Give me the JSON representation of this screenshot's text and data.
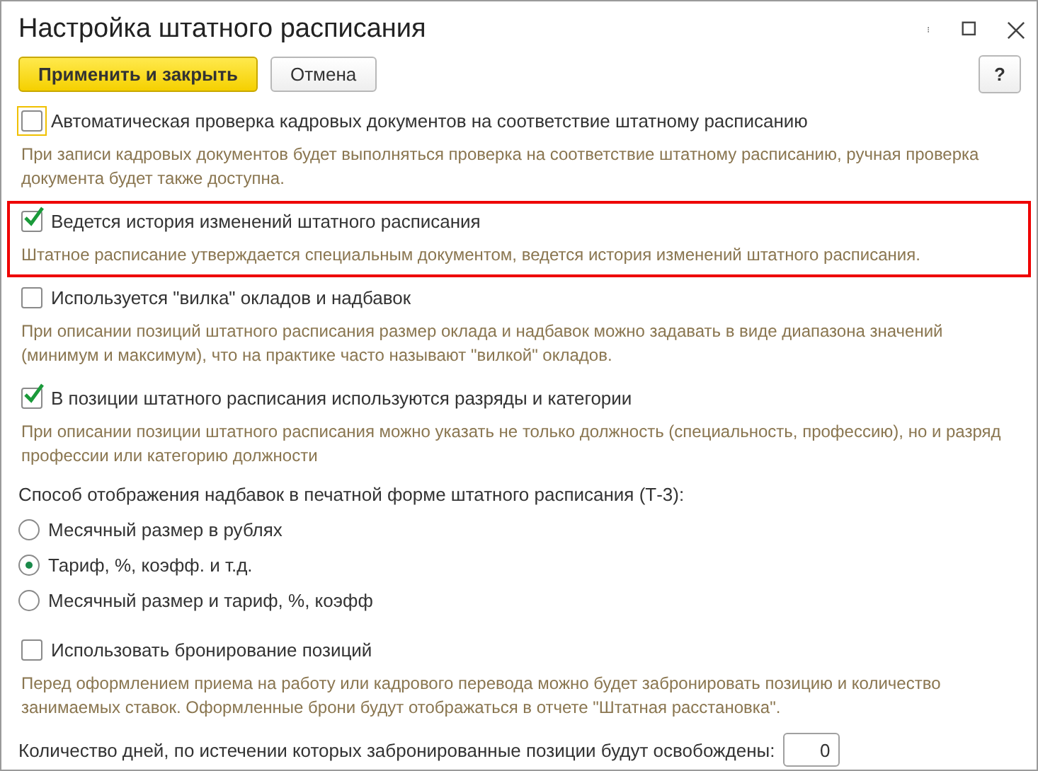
{
  "window": {
    "title": "Настройка штатного расписания"
  },
  "toolbar": {
    "buttons": [
      {
        "label": "Применить и закрыть",
        "kind": "primary"
      },
      {
        "label": "Отмена",
        "kind": "normal"
      }
    ],
    "help": "?"
  },
  "settings": [
    {
      "kind": "checkbox",
      "label": "Автоматическая проверка кадровых документов на соответствие штатному расписанию",
      "checked": false,
      "focused": true,
      "highlighted": false,
      "hint": "При записи кадровых документов будет выполняться проверка на соответствие штатному расписанию, ручная проверка документа будет также доступна."
    },
    {
      "kind": "checkbox",
      "label": "Ведется история изменений штатного расписания",
      "checked": true,
      "focused": false,
      "highlighted": true,
      "hint": "Штатное расписание утверждается специальным документом, ведется история изменений штатного расписания."
    },
    {
      "kind": "checkbox",
      "label": "Используется \"вилка\" окладов и надбавок",
      "checked": false,
      "focused": false,
      "highlighted": false,
      "hint": "При описании позиций штатного расписания размер оклада и надбавок можно задавать в виде диапазона значений (минимум и максимум), что на практике часто называют \"вилкой\" окладов."
    },
    {
      "kind": "checkbox",
      "label": "В позиции штатного расписания используются разряды и категории",
      "checked": true,
      "focused": false,
      "highlighted": false,
      "hint": "При описании позиции штатного расписания можно указать не только должность (специальность, профессию), но и разряд профессии или категорию должности"
    },
    {
      "kind": "radio_group",
      "label": "Способ отображения надбавок в печатной форме штатного расписания (Т-3):",
      "options": [
        {
          "label": "Месячный размер в рублях",
          "selected": false
        },
        {
          "label": "Тариф, %, коэфф. и т.д.",
          "selected": true
        },
        {
          "label": "Месячный размер и тариф, %, коэфф",
          "selected": false
        }
      ]
    },
    {
      "kind": "checkbox",
      "label": "Использовать бронирование позиций",
      "checked": false,
      "focused": false,
      "highlighted": false,
      "hint": "Перед оформлением приема на работу или кадрового перевода можно будет забронировать позицию и количество занимаемых ставок. Оформленные брони будут отображаться в отчете \"Штатная расстановка\"."
    },
    {
      "kind": "number",
      "label": "Количество дней, по истечении которых забронированные позиции будут освобождены:",
      "value": "0"
    }
  ]
}
